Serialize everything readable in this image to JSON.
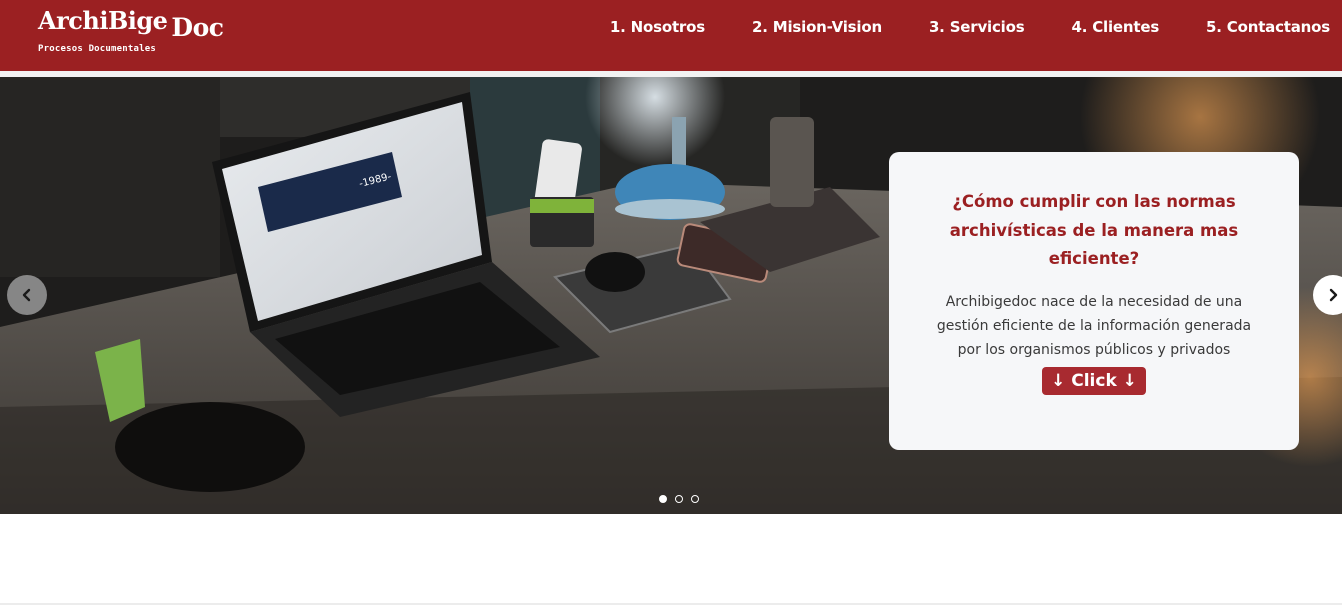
{
  "brand": {
    "name": "ArchiBige",
    "name_suffix": "Doc",
    "tagline": "Procesos Documentales"
  },
  "nav": {
    "items": [
      {
        "label": "1. Nosotros"
      },
      {
        "label": "2. Mision-Vision"
      },
      {
        "label": "3. Servicios"
      },
      {
        "label": "4. Clientes"
      },
      {
        "label": "5. Contactanos"
      }
    ]
  },
  "carousel": {
    "caption": {
      "title": "¿Cómo cumplir con las normas archivísticas de la manera mas eficiente?",
      "text": "Archibigedoc nace de la necesidad de una gestión eficiente de la información generada por los organismos públicos y privados",
      "button_label": "↓ Click ↓"
    },
    "prev_icon": "chevron-left-icon",
    "next_icon": "chevron-right-icon",
    "slide_count": 3,
    "active_slide": 1
  },
  "colors": {
    "brand": "#9b2022",
    "button": "#a82a30",
    "card_bg": "#f6f7f9"
  }
}
